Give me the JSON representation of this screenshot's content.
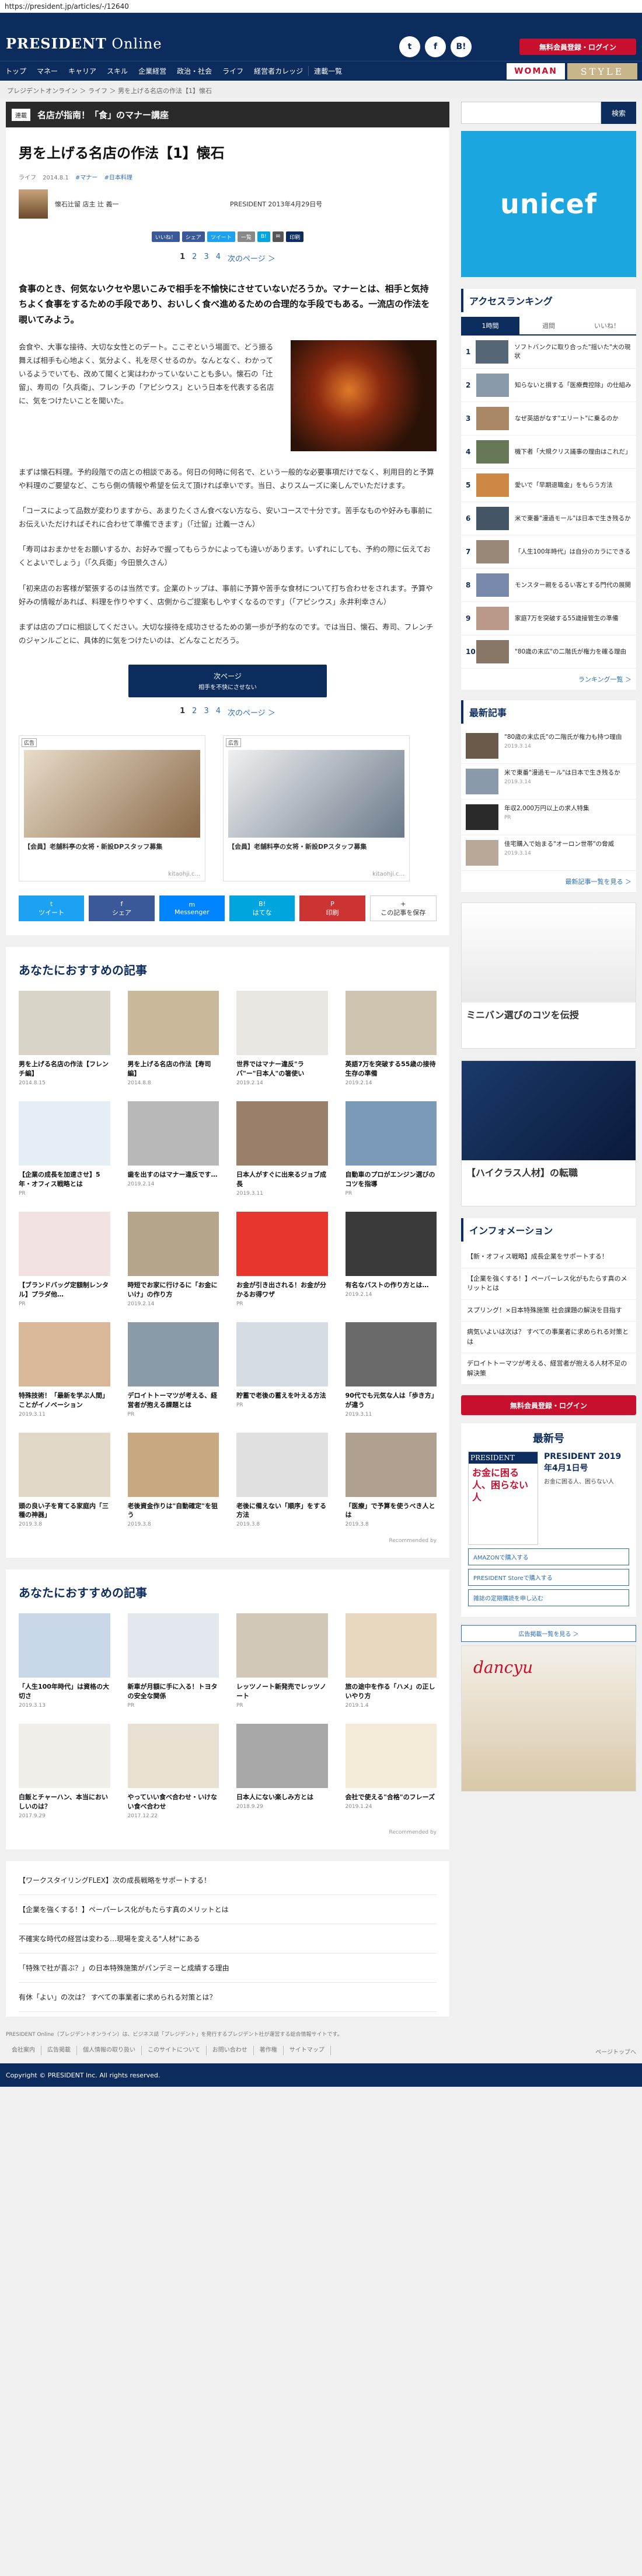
{
  "url": "https://president.jp/articles/-/12640",
  "header": {
    "logo_bold": "PRESIDENT",
    "logo_rest": " Online",
    "social": [
      "t",
      "f",
      "B!"
    ],
    "login": "無料会員登録・ログイン"
  },
  "nav": {
    "items": [
      "トップ",
      "マネー",
      "キャリア",
      "スキル",
      "企業経営",
      "政治・社会",
      "ライフ",
      "経営者カレッジ",
      "連載一覧"
    ],
    "woman": "WOMAN",
    "style": "STYLE"
  },
  "breadcrumb": "プレジデントオンライン ＞ ライフ ＞ 男を上げる名店の作法【1】懐石",
  "category": {
    "badge": "連載",
    "title": "名店が指南！「食」のマナー講座"
  },
  "article": {
    "title": "男を上げる名店の作法【1】懐石",
    "meta": [
      "ライフ",
      "2014.8.1",
      "#マナー",
      "#日本料理"
    ],
    "author": "懐石辻留 店主 辻 義一",
    "pubdate": "PRESIDENT 2013年4月29日号",
    "share": [
      "いいね！",
      "シェア",
      "ツイート",
      "一覧",
      "B!",
      "✉",
      "印刷"
    ],
    "pager": {
      "pages": [
        "1",
        "2",
        "3",
        "4"
      ],
      "next": "次のページ ＞"
    },
    "lead": "食事のとき、何気ないクセや思いこみで相手を不愉快にさせていないだろうか。マナーとは、相手と気持ちよく食事をするための手段であり、おいしく食べ進めるための合理的な手段でもある。一流店の作法を覗いてみよう。",
    "intro": "会食や、大事な接待、大切な女性とのデート。ここぞという場面で、どう振る舞えば相手も心地よく、気分よく、礼を尽くせるのか。なんとなく、わかっているようでいても、改めて聞くと実はわかっていないことも多い。懐石の「辻留」、寿司の「久兵衛」、フレンチの「アピシウス」という日本を代表する名店に、気をつけたいことを聞いた。",
    "paragraphs": [
      "まずは懐石料理。予約段階での店との相談である。何日の何時に何名で、という一般的な必要事項だけでなく、利用目的と予算や料理のご要望など、こちら側の情報や希望を伝えて頂ければ幸いです。当日、よりスムーズに楽しんでいただけます。",
      "「コースによって品数が変わりますから、あまりたくさん食べない方なら、安いコースで十分です。苦手なものや好みも事前にお伝えいただければそれに合わせて準備できます」（「辻留」辻義一さん）",
      "「寿司はおまかせをお願いするか、お好みで握ってもらうかによっても違いがあります。いずれにしても、予約の際に伝えておくとよいでしょう」（「久兵衛」今田景久さん）",
      "「初来店のお客様が緊張するのは当然です。企業のトップは、事前に予算や苦手な食材について打ち合わせをされます。予算や好みの情報があれば、料理を作りやすく、店側からご提案もしやすくなるのです」（「アピシウス」永井利幸さん）",
      "まずは店のプロに相談してください。大切な接待を成功させるための第一歩が予約なのです。では当日、懐石、寿司、フレンチのジャンルごとに、具体的に気をつけたいのは、どんなことだろう。"
    ],
    "nextbtn": {
      "label": "次ページ",
      "sub": "相手を不快にさせない"
    }
  },
  "ads": [
    {
      "tag": "広告",
      "text": "【会員】老舗料亭の女将・新設DPスタッフ募集",
      "src": "kitaohji.c..."
    },
    {
      "tag": "広告",
      "text": "【会員】老舗料亭の女将・新設DPスタッフ募集",
      "src": "kitaohji.c..."
    }
  ],
  "sharebig": [
    {
      "icon": "t",
      "label": "ツイート",
      "color": "#1da1f2"
    },
    {
      "icon": "f",
      "label": "シェア",
      "color": "#3b5998"
    },
    {
      "icon": "m",
      "label": "Messenger",
      "color": "#0084ff"
    },
    {
      "icon": "B!",
      "label": "はてな",
      "color": "#00a4de"
    },
    {
      "icon": "P",
      "label": "印刷",
      "color": "#cc3333"
    },
    {
      "icon": "+",
      "label": "この記事を保存",
      "color": "#ffffff"
    }
  ],
  "rec1": {
    "title": "あなたにおすすめの記事",
    "items": [
      {
        "t": "男を上げる名店の作法【フレンチ編】",
        "d": "2014.8.15",
        "c": "#d9d4c8"
      },
      {
        "t": "男を上げる名店の作法【寿司編】",
        "d": "2014.8.8",
        "c": "#c9b89a"
      },
      {
        "t": "世界ではマナー違反\"ラバ\"ー\"日本人\"の箸使い",
        "d": "2019.2.14",
        "c": "#e8e6e0"
      },
      {
        "t": "英語7万を突破する55歳の接待生存の準備",
        "d": "2019.2.14",
        "c": "#cfc4b0"
      },
      {
        "t": "【企業の成長を加速させ】5年・オフィス戦略とは",
        "d": "PR",
        "c": "#e5eef5"
      },
      {
        "t": "歯を出すのはマナー違反です…",
        "d": "2019.2.14",
        "c": "#b8b8b8"
      },
      {
        "t": "日本人がすぐに出来るジョブ成長",
        "d": "2019.3.11",
        "c": "#9a7f6a"
      },
      {
        "t": "自動車のプロがエンジン選びのコツを指導",
        "d": "PR",
        "c": "#7a9ab8"
      },
      {
        "t": "【ブランドバッグ定額制レンタル】プラダ他…",
        "d": "PR",
        "c": "#f3e2e2"
      },
      {
        "t": "時短でお家に行けるに「お金にいけ」の作り方",
        "d": "2019.2.14",
        "c": "#b5a58a"
      },
      {
        "t": "お金が引き出される！お金が分かるお得ワザ",
        "d": "PR",
        "c": "#e8352e"
      },
      {
        "t": "有名なバストの作り方とは…",
        "d": "2019.2.14",
        "c": "#3a3a3a"
      },
      {
        "t": "特殊技術！「最新を学ぶ人間」ことがイノベーション",
        "d": "2019.3.11",
        "c": "#d8b898"
      },
      {
        "t": "デロイトトーマツが考える、経営者が抱える課題とは",
        "d": "PR",
        "c": "#8a9aa8"
      },
      {
        "t": "貯蓄で老後の蓄えを叶える方法",
        "d": "PR",
        "c": "#d5dde2"
      },
      {
        "t": "90代でも元気な人は「歩き方」が違う",
        "d": "2019.3.11",
        "c": "#6a6a6a"
      },
      {
        "t": "頭の良い子を育てる家庭内「三種の神器」",
        "d": "2019.3.8",
        "c": "#e2d8c8"
      },
      {
        "t": "老後資金作りは\"自動確定\"を狙う",
        "d": "2019.3.8",
        "c": "#c8a880"
      },
      {
        "t": "老後に備えない「順序」をする方法",
        "d": "2019.3.8",
        "c": "#e0e0e0"
      },
      {
        "t": "「医療」で予算を使うべき人とは",
        "d": "2019.3.8",
        "c": "#b0a090"
      }
    ]
  },
  "rec2": {
    "title": "あなたにおすすめの記事",
    "items": [
      {
        "t": "「人生100年時代」は資格の大切さ",
        "d": "2019.3.13",
        "c": "#c8d8e8"
      },
      {
        "t": "新車が月額に手に入る！トヨタの安全な関係",
        "d": "PR",
        "c": "#e2e8ee"
      },
      {
        "t": "レッツノート新発売でレッツノート",
        "d": "PR",
        "c": "#d2c8b8"
      },
      {
        "t": "旅の途中を作る「ハメ」の正しいやり方",
        "d": "2019.1.4",
        "c": "#e8d8c0"
      },
      {
        "t": "白飯とチャーハン、本当においしいのは？",
        "d": "2017.9.29",
        "c": "#f0eee8"
      },
      {
        "t": "やっていい食べ合わせ・いけない食べ合わせ",
        "d": "2017.12.22",
        "c": "#e8e0d0"
      },
      {
        "t": "日本人にない楽しみ方とは",
        "d": "2018.9.29",
        "c": "#a8a8a8"
      },
      {
        "t": "会社で使える\"合格\"のフレーズ",
        "d": "2019.1.24",
        "c": "#f4ead8"
      }
    ]
  },
  "poweredby": "Recommended by",
  "footlinks": [
    "【ワークスタイリングFLEX】次の成長戦略をサポートする！",
    "【企業を強くする！】ペーパーレス化がもたらす真のメリットとは",
    "不確実な時代の経営は変わる…現場を変える\"人材\"にある",
    "「特殊で社が喜ぶ？」の日本特殊施策がパンデミーと成績する理由",
    "有休「よい」の次は？ すべての事業者に求められる対策とは？"
  ],
  "sidebar": {
    "search_placeholder": "",
    "search_button": "検索",
    "unicef": "unicef",
    "ranking_title": "アクセスランキング",
    "ranking_tabs": [
      "1時間",
      "週間",
      "いいね！"
    ],
    "ranking": [
      "ソフトバンクに取り合った\"揺いた\"大の現状",
      "知らないと損する「医療費控除」の仕組み",
      "なぜ英語がなす\"エリート\"に乗るのか",
      "機下者「大規クリス議事の理由はこれだ」",
      "愛いで「早期退職金」をもらう方法",
      "米で東番\"漫過モール\"は日本で生き残るか",
      "「人生100年時代」は自分のカラにできる",
      "モンスター親をるるい客とする門代の展開",
      "家庭7万を突破する55歳接管生の準備",
      "\"80歳の末広\"の二階氏が権力を確る理由"
    ],
    "ranking_more": "ランキング一覧 ＞",
    "latest_title": "最新記事",
    "latest": [
      {
        "t": "\"80歳の末広氏\"の二階氏が権力も持つ理由",
        "d": "2019.3.14"
      },
      {
        "t": "米で東番\"漫過モール\"は日本で生き残るか",
        "d": "2019.3.14"
      },
      {
        "t": "年収2,000万円以上の求人特集",
        "d": "PR"
      },
      {
        "t": "佳宅購入で始まる\"オーロン世帯\"の脅威",
        "d": "2019.3.14"
      }
    ],
    "latest_more": "最新記事一覧を見る ＞",
    "ad1_text": "ミニバン選びのコツを伝授",
    "ad2_text": "【ハイクラス人材】の転職",
    "info_title": "インフォメーション",
    "info": [
      "【新・オフィス戦略】成長企業をサポートする！",
      "【企業を強くする！】ペーパーレス化がもたらす真のメリットとは",
      "スプリング！×日本特殊施策 社会課題の解決を目指す",
      "病気いよいは次は？ すべての事業者に求められる対策とは",
      "デロイトトーマツが考える、経営者が抱える人材不足の解決策"
    ],
    "login": "無料会員登録・ログイン",
    "issue_title": "最新号",
    "issue_cover_top": "PRESIDENT",
    "issue_cover_main": "お金に困る人、困らない人",
    "issue_name": "PRESIDENT 2019年4月1日号",
    "issue_desc": "お金に困る人、困らない人",
    "stores": [
      "AMAZONで購入する",
      "PRESIDENT Storeで購入する",
      "雑誌の定期購読を申し込む"
    ],
    "ad_list": "広告掲載一覧を見る ＞",
    "dancyu": "dancyu"
  },
  "legal": "PRESIDENT Online（プレジデントオンライン）は、ビジネス誌「プレジデント」を発行するプレジデント社が運営する総合情報サイトです。",
  "footnav": [
    "会社案内",
    "広告掲載",
    "個人情報の取り扱い",
    "このサイトについて",
    "お問い合わせ",
    "著作権",
    "サイトマップ"
  ],
  "pagetop": "ページトップへ",
  "copyright": "Copyright © PRESIDENT Inc. All rights reserved."
}
